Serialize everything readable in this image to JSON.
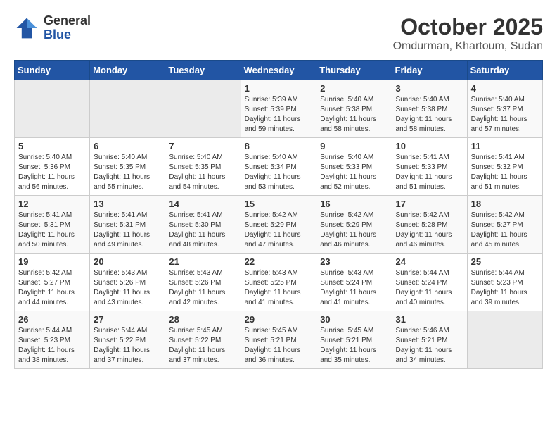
{
  "header": {
    "logo_line1": "General",
    "logo_line2": "Blue",
    "month": "October 2025",
    "location": "Omdurman, Khartoum, Sudan"
  },
  "weekdays": [
    "Sunday",
    "Monday",
    "Tuesday",
    "Wednesday",
    "Thursday",
    "Friday",
    "Saturday"
  ],
  "weeks": [
    [
      {
        "day": "",
        "info": ""
      },
      {
        "day": "",
        "info": ""
      },
      {
        "day": "",
        "info": ""
      },
      {
        "day": "1",
        "info": "Sunrise: 5:39 AM\nSunset: 5:39 PM\nDaylight: 11 hours\nand 59 minutes."
      },
      {
        "day": "2",
        "info": "Sunrise: 5:40 AM\nSunset: 5:38 PM\nDaylight: 11 hours\nand 58 minutes."
      },
      {
        "day": "3",
        "info": "Sunrise: 5:40 AM\nSunset: 5:38 PM\nDaylight: 11 hours\nand 58 minutes."
      },
      {
        "day": "4",
        "info": "Sunrise: 5:40 AM\nSunset: 5:37 PM\nDaylight: 11 hours\nand 57 minutes."
      }
    ],
    [
      {
        "day": "5",
        "info": "Sunrise: 5:40 AM\nSunset: 5:36 PM\nDaylight: 11 hours\nand 56 minutes."
      },
      {
        "day": "6",
        "info": "Sunrise: 5:40 AM\nSunset: 5:35 PM\nDaylight: 11 hours\nand 55 minutes."
      },
      {
        "day": "7",
        "info": "Sunrise: 5:40 AM\nSunset: 5:35 PM\nDaylight: 11 hours\nand 54 minutes."
      },
      {
        "day": "8",
        "info": "Sunrise: 5:40 AM\nSunset: 5:34 PM\nDaylight: 11 hours\nand 53 minutes."
      },
      {
        "day": "9",
        "info": "Sunrise: 5:40 AM\nSunset: 5:33 PM\nDaylight: 11 hours\nand 52 minutes."
      },
      {
        "day": "10",
        "info": "Sunrise: 5:41 AM\nSunset: 5:33 PM\nDaylight: 11 hours\nand 51 minutes."
      },
      {
        "day": "11",
        "info": "Sunrise: 5:41 AM\nSunset: 5:32 PM\nDaylight: 11 hours\nand 51 minutes."
      }
    ],
    [
      {
        "day": "12",
        "info": "Sunrise: 5:41 AM\nSunset: 5:31 PM\nDaylight: 11 hours\nand 50 minutes."
      },
      {
        "day": "13",
        "info": "Sunrise: 5:41 AM\nSunset: 5:31 PM\nDaylight: 11 hours\nand 49 minutes."
      },
      {
        "day": "14",
        "info": "Sunrise: 5:41 AM\nSunset: 5:30 PM\nDaylight: 11 hours\nand 48 minutes."
      },
      {
        "day": "15",
        "info": "Sunrise: 5:42 AM\nSunset: 5:29 PM\nDaylight: 11 hours\nand 47 minutes."
      },
      {
        "day": "16",
        "info": "Sunrise: 5:42 AM\nSunset: 5:29 PM\nDaylight: 11 hours\nand 46 minutes."
      },
      {
        "day": "17",
        "info": "Sunrise: 5:42 AM\nSunset: 5:28 PM\nDaylight: 11 hours\nand 46 minutes."
      },
      {
        "day": "18",
        "info": "Sunrise: 5:42 AM\nSunset: 5:27 PM\nDaylight: 11 hours\nand 45 minutes."
      }
    ],
    [
      {
        "day": "19",
        "info": "Sunrise: 5:42 AM\nSunset: 5:27 PM\nDaylight: 11 hours\nand 44 minutes."
      },
      {
        "day": "20",
        "info": "Sunrise: 5:43 AM\nSunset: 5:26 PM\nDaylight: 11 hours\nand 43 minutes."
      },
      {
        "day": "21",
        "info": "Sunrise: 5:43 AM\nSunset: 5:26 PM\nDaylight: 11 hours\nand 42 minutes."
      },
      {
        "day": "22",
        "info": "Sunrise: 5:43 AM\nSunset: 5:25 PM\nDaylight: 11 hours\nand 41 minutes."
      },
      {
        "day": "23",
        "info": "Sunrise: 5:43 AM\nSunset: 5:24 PM\nDaylight: 11 hours\nand 41 minutes."
      },
      {
        "day": "24",
        "info": "Sunrise: 5:44 AM\nSunset: 5:24 PM\nDaylight: 11 hours\nand 40 minutes."
      },
      {
        "day": "25",
        "info": "Sunrise: 5:44 AM\nSunset: 5:23 PM\nDaylight: 11 hours\nand 39 minutes."
      }
    ],
    [
      {
        "day": "26",
        "info": "Sunrise: 5:44 AM\nSunset: 5:23 PM\nDaylight: 11 hours\nand 38 minutes."
      },
      {
        "day": "27",
        "info": "Sunrise: 5:44 AM\nSunset: 5:22 PM\nDaylight: 11 hours\nand 37 minutes."
      },
      {
        "day": "28",
        "info": "Sunrise: 5:45 AM\nSunset: 5:22 PM\nDaylight: 11 hours\nand 37 minutes."
      },
      {
        "day": "29",
        "info": "Sunrise: 5:45 AM\nSunset: 5:21 PM\nDaylight: 11 hours\nand 36 minutes."
      },
      {
        "day": "30",
        "info": "Sunrise: 5:45 AM\nSunset: 5:21 PM\nDaylight: 11 hours\nand 35 minutes."
      },
      {
        "day": "31",
        "info": "Sunrise: 5:46 AM\nSunset: 5:21 PM\nDaylight: 11 hours\nand 34 minutes."
      },
      {
        "day": "",
        "info": ""
      }
    ]
  ]
}
